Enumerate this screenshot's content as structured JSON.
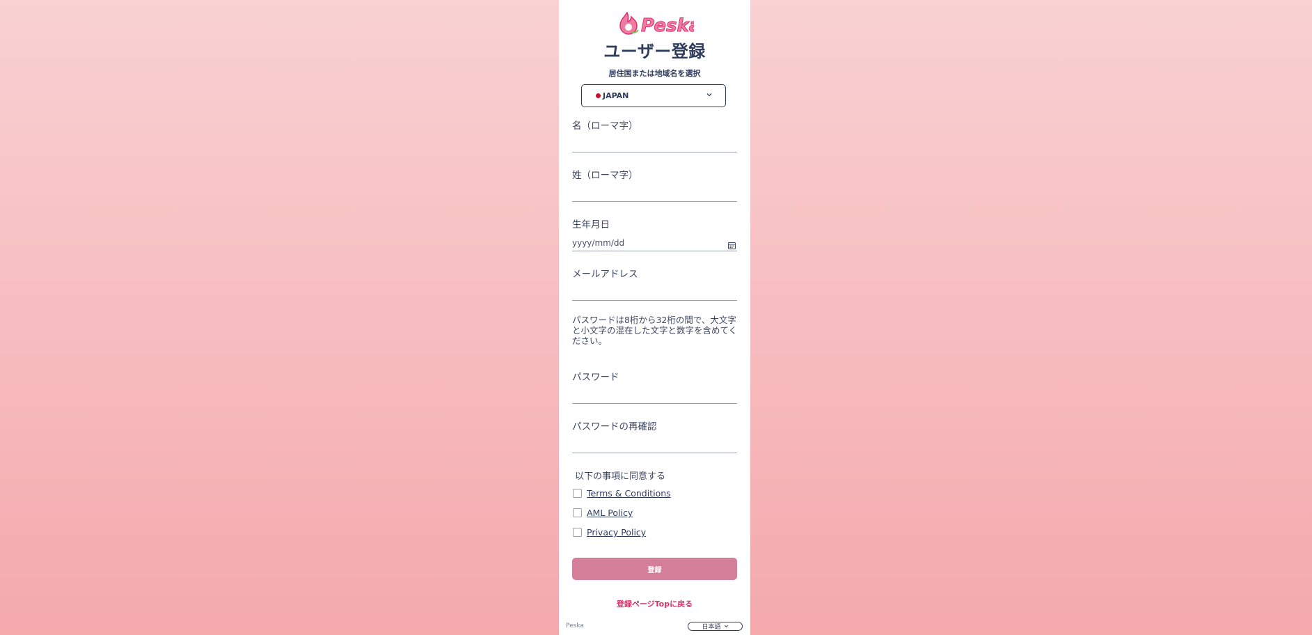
{
  "brand": {
    "logo_text": "Peska",
    "footer_name": "Peska"
  },
  "page": {
    "title": "ユーザー登録"
  },
  "country": {
    "label": "居住国または地域名を選択",
    "selected": "JAPAN"
  },
  "fields": {
    "first_name_label": "名（ローマ字）",
    "last_name_label": "姓（ローマ字）",
    "birthdate_label": "生年月日",
    "birthdate_placeholder": "yyyy/mm/dd",
    "email_label": "メールアドレス",
    "password_hint": "パスワードは8桁から32桁の間で、大文字と小文字の混在した文字と数字を含めてください。",
    "password_label": "パスワード",
    "password_confirm_label": "パスワードの再確認"
  },
  "agreement": {
    "label": "以下の事項に同意する",
    "items": [
      {
        "label": "Terms & Conditions"
      },
      {
        "label": "AML Policy"
      },
      {
        "label": "Privacy Policy"
      }
    ]
  },
  "actions": {
    "submit_label": "登録",
    "back_label": "登録ページTopに戻る"
  },
  "footer": {
    "language": "日本語"
  },
  "colors": {
    "accent": "#d6336c",
    "button": "#d47f99",
    "text": "#2f3c5c"
  }
}
